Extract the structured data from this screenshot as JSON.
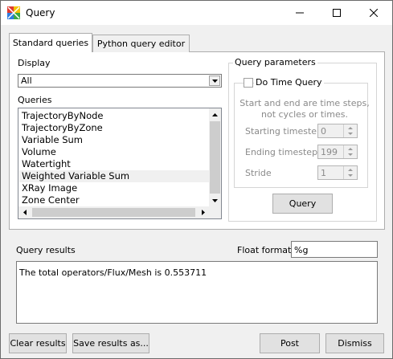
{
  "window": {
    "title": "Query"
  },
  "tabs": [
    {
      "label": "Standard queries",
      "active": true
    },
    {
      "label": "Python query editor",
      "active": false
    }
  ],
  "display": {
    "label": "Display",
    "selected": "All"
  },
  "queries": {
    "label": "Queries",
    "items": [
      "TrajectoryByNode",
      "TrajectoryByZone",
      "Variable Sum",
      "Volume",
      "Watertight",
      "Weighted Variable Sum",
      "XRay Image",
      "Zone Center"
    ],
    "selected_index": 5
  },
  "query_parameters": {
    "title": "Query parameters",
    "do_time_query": {
      "label": "Do Time Query",
      "checked": false
    },
    "note_line1": "Start and end are time steps,",
    "note_line2": "not cycles or times.",
    "starting_timestep": {
      "label": "Starting timestep",
      "value": "0"
    },
    "ending_timestep": {
      "label": "Ending timestep",
      "value": "199"
    },
    "stride": {
      "label": "Stride",
      "value": "1"
    },
    "query_button": "Query"
  },
  "results": {
    "label": "Query results",
    "float_format_label": "Float format",
    "float_format_value": "%g",
    "text": "The total operators/Flux/Mesh is 0.553711"
  },
  "buttons": {
    "clear": "Clear results",
    "save": "Save results as...",
    "post": "Post",
    "dismiss": "Dismiss"
  },
  "colors": {
    "window_bg": "#f0f0f0",
    "panel_bg": "#ffffff",
    "disabled_text": "#8a8a8a",
    "border": "#adadad"
  }
}
